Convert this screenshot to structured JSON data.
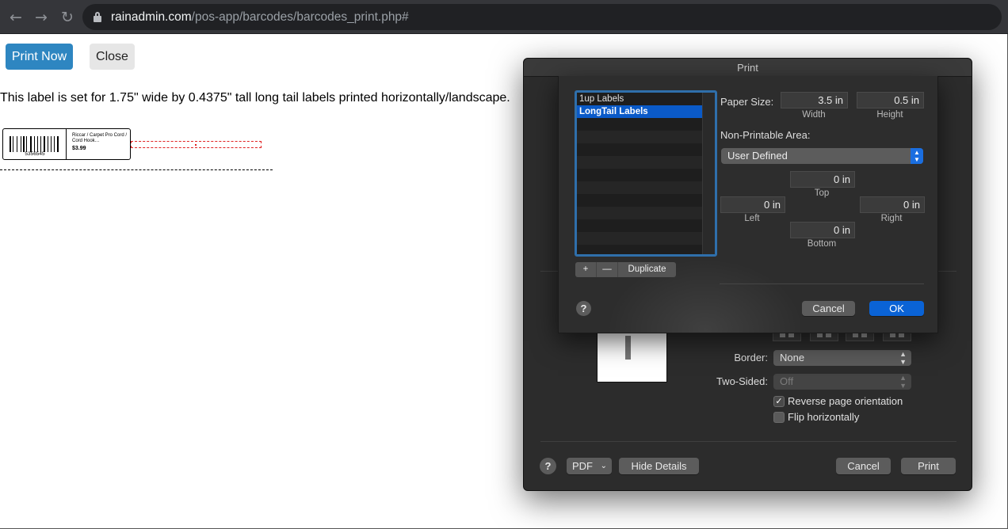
{
  "browser": {
    "back_icon": "←",
    "forward_icon": "→",
    "reload_icon": "↻",
    "url_domain": "rainadmin.com",
    "url_path": "/pos-app/barcodes/barcodes_print.php#"
  },
  "page": {
    "print_now_label": "Print Now",
    "close_label": "Close",
    "description": "This label is set for 1.75\" wide by 0.4375\" tall long tail labels printed horizontally/landscape.",
    "label": {
      "barcode_number": "5356545",
      "product_name": "Riccar / Carpet Pro Cord / Cord Hook…",
      "price": "$3.99"
    }
  },
  "print_dialog": {
    "title": "Print",
    "border_label": "Border:",
    "border_value": "None",
    "two_sided_label": "Two-Sided:",
    "two_sided_value": "Off",
    "reverse_label": "Reverse page orientation",
    "reverse_checked": true,
    "flip_label": "Flip horizontally",
    "flip_checked": false,
    "help": "?",
    "pdf_label": "PDF",
    "hide_details_label": "Hide Details",
    "cancel_label": "Cancel",
    "print_label": "Print"
  },
  "paper_sheet": {
    "sizes": [
      "1up Labels",
      "LongTail Labels"
    ],
    "selected_index": 1,
    "add": "+",
    "remove": "—",
    "duplicate": "Duplicate",
    "paper_size_label": "Paper Size:",
    "width_value": "3.5 in",
    "width_caption": "Width",
    "height_value": "0.5 in",
    "height_caption": "Height",
    "non_printable_label": "Non-Printable Area:",
    "non_printable_value": "User Defined",
    "top_value": "0 in",
    "top_caption": "Top",
    "left_value": "0 in",
    "left_caption": "Left",
    "right_value": "0 in",
    "right_caption": "Right",
    "bottom_value": "0 in",
    "bottom_caption": "Bottom",
    "help": "?",
    "cancel_label": "Cancel",
    "ok_label": "OK"
  }
}
